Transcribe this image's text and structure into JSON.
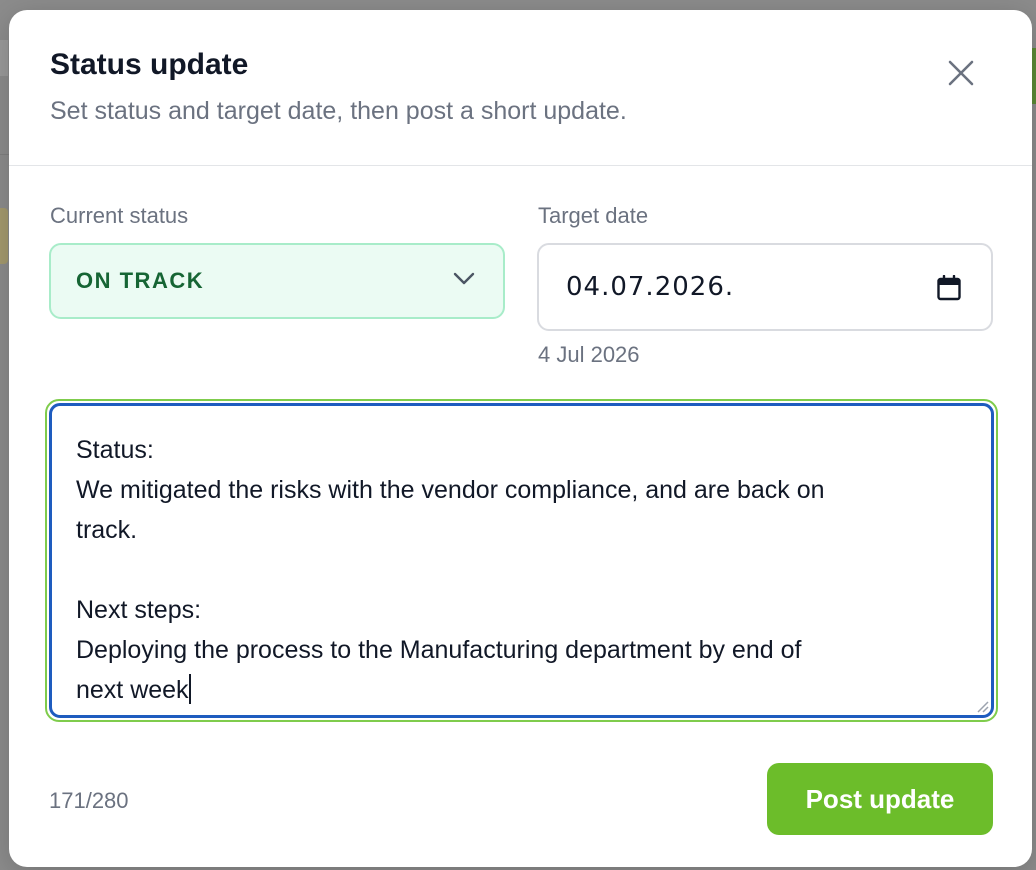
{
  "modal": {
    "title": "Status update",
    "subtitle": "Set status and target date, then post a short update."
  },
  "status": {
    "label": "Current status",
    "value": "ON TRACK"
  },
  "target_date": {
    "label": "Target date",
    "value": "04.07.2026.",
    "hint": "4 Jul 2026"
  },
  "update": {
    "text": "Status:\nWe mitigated the risks with the vendor compliance, and are back on\ntrack.\n\nNext steps:\nDeploying the process to the Manufacturing department by end of\nnext week",
    "char_count": "171/280"
  },
  "actions": {
    "post_label": "Post update"
  },
  "icons": {
    "close": "close-icon",
    "chevron": "chevron-down-icon",
    "calendar": "calendar-icon",
    "resize": "resize-handle-icon"
  },
  "colors": {
    "status_bg": "#ebfbf3",
    "status_text": "#166534",
    "focus_ring": "#1e5cbf",
    "accent": "#6cbd2a"
  }
}
